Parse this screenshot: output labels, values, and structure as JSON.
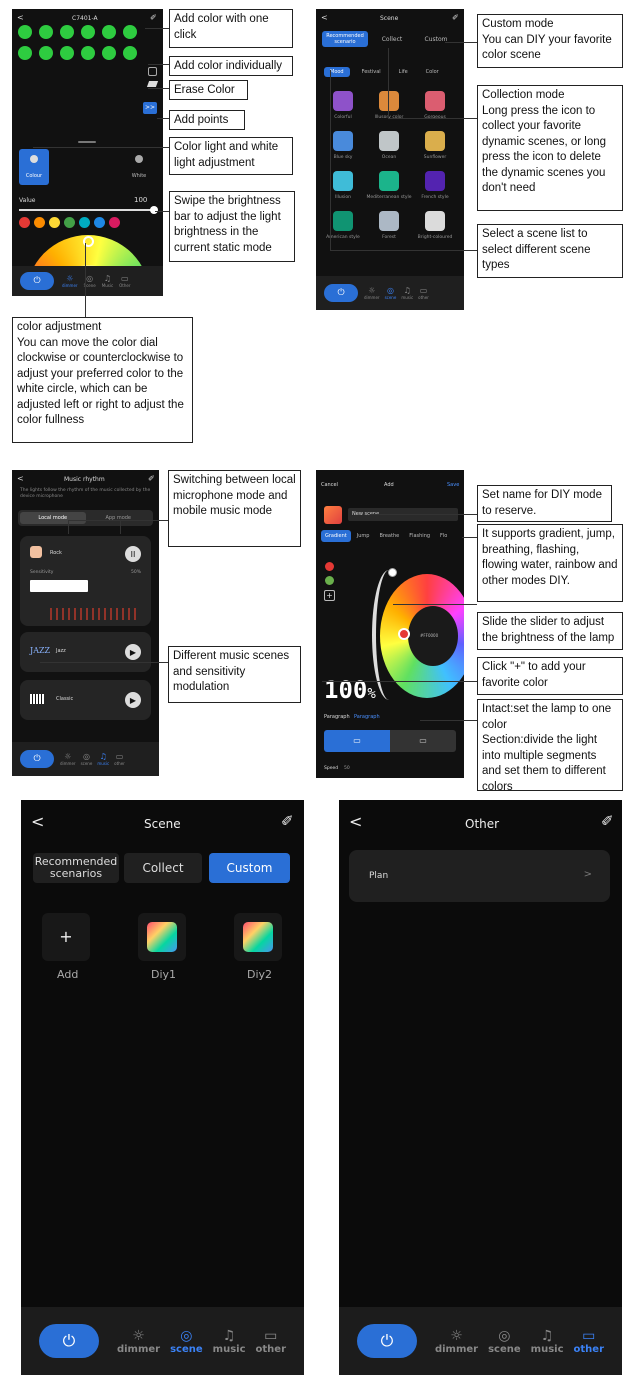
{
  "panel_dimmer": {
    "title": "C7401-A",
    "back": "<",
    "edit": "✐",
    "modes": [
      "Colour",
      "White"
    ],
    "value_label": "Value",
    "value": "100",
    "brightness_fraction": 1.0,
    "nav": [
      "dimmer",
      "Scene",
      "Music",
      "Other"
    ],
    "swatch_colors": [
      "#e53935",
      "#fb8c00",
      "#fdd835",
      "#43a047",
      "#00acc1",
      "#1e88e5",
      "#d81b60"
    ],
    "preset_dot_color": "#2ecc40"
  },
  "panel_scene_small": {
    "title": "Scene",
    "tabs": [
      "Recommended scenario",
      "Collect",
      "Custom"
    ],
    "categories": [
      "Mood",
      "Festival",
      "Life",
      "Color"
    ],
    "scenes": [
      "Colorful",
      "Illusory color",
      "Gorgeous",
      "Blue sky",
      "Ocean",
      "Sunflower",
      "Illusion",
      "Mediterranean style",
      "French style",
      "American style",
      "Forest",
      "Bright-coloured"
    ],
    "nav": [
      "dimmer",
      "scene",
      "music",
      "other"
    ]
  },
  "panel_music": {
    "title": "Music rhythm",
    "subtitle": "The lights follow the rhythm of the music collected by the device microphone",
    "tabs": [
      "Local mode",
      "App mode"
    ],
    "items": [
      "Rock",
      "Jazz",
      "Classic"
    ],
    "sensitivity_label": "Sensitivity",
    "sensitivity_value": "50%",
    "nav": [
      "dimmer",
      "scene",
      "music",
      "other"
    ]
  },
  "panel_add": {
    "cancel": "Cancel",
    "title": "Add",
    "save": "Save",
    "scene_name": "New scene",
    "modes": [
      "Gradient",
      "Jump",
      "Breathe",
      "Flashing",
      "Flo"
    ],
    "value": "100",
    "unit": "%",
    "color_code": "#FF0000",
    "paragraph_label": "Paragraph",
    "paragraph_value": "Paragraph",
    "speed_label": "Speed",
    "speed_value": "50"
  },
  "panel_scene_large": {
    "back": "<",
    "title": "Scene",
    "edit": "✐",
    "tabs": [
      "Recommended\nscenarios",
      "Collect",
      "Custom"
    ],
    "items": [
      {
        "label": "Add",
        "icon": "+"
      },
      {
        "label": "Diy1"
      },
      {
        "label": "Diy2"
      }
    ],
    "power": "⏻",
    "nav": [
      "dimmer",
      "scene",
      "music",
      "other"
    ]
  },
  "panel_other": {
    "back": "<",
    "title": "Other",
    "edit": "✐",
    "plan": "Plan",
    "chevron": ">",
    "power": "⏻",
    "nav": [
      "dimmer",
      "scene",
      "music",
      "other"
    ]
  },
  "notes": {
    "add_one_click": "Add color with one click",
    "add_individually": "Add color individually",
    "erase": "Erase Color",
    "add_points": "Add points",
    "color_white": "Color light and white light adjustment",
    "brightness": "Swipe the brightness bar to adjust the light brightness in the current static mode",
    "color_adjust": "color adjustment\nYou can move the color dial clockwise or counterclockwise to adjust your preferred color to the white circle, which can be adjusted left or right to adjust the color fullness",
    "custom": "Custom mode\nYou can DIY your favorite color scene",
    "collection": "Collection mode\nLong press the icon to collect your favorite dynamic scenes, or long press the icon to delete the dynamic scenes you don't need",
    "scene_list": "Select a scene list to select different scene types",
    "music_switch": "Switching between local microphone mode and mobile music mode",
    "music_scenes": "Different music scenes and sensitivity modulation",
    "set_name": "Set name for DIY mode to reserve.",
    "supports": "It supports gradient, jump, breathing, flashing, flowing water, rainbow and other modes DIY.",
    "slider": "Slide the slider to adjust the brightness of the lamp",
    "plus": "Click \"+\" to add your favorite color",
    "intact": "Intact:set the lamp to one color\nSection:divide the light into multiple segments and set them to different colors"
  }
}
